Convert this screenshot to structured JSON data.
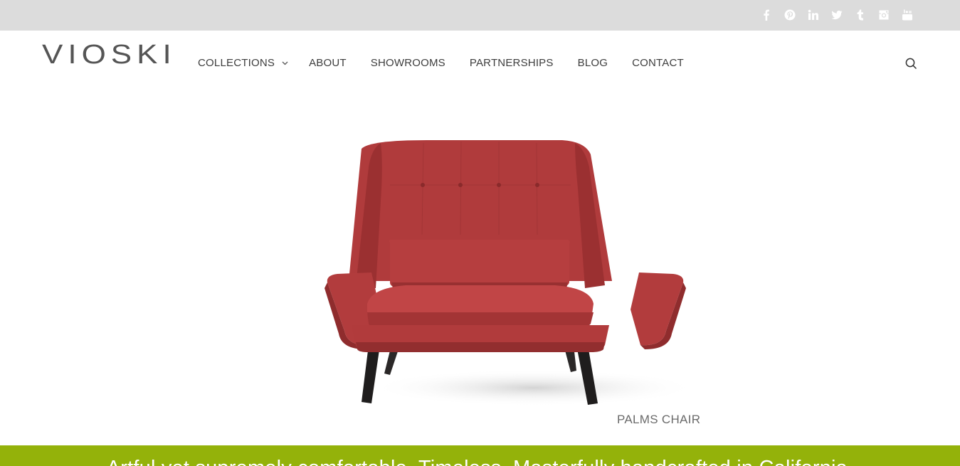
{
  "brand": {
    "name": "VIOSKI"
  },
  "social": [
    {
      "name": "facebook-icon"
    },
    {
      "name": "pinterest-icon"
    },
    {
      "name": "linkedin-icon"
    },
    {
      "name": "twitter-icon"
    },
    {
      "name": "tumblr-icon"
    },
    {
      "name": "instagram-icon"
    },
    {
      "name": "youtube-icon"
    }
  ],
  "nav": {
    "items": [
      {
        "label": "COLLECTIONS",
        "has_dropdown": true
      },
      {
        "label": "ABOUT"
      },
      {
        "label": "SHOWROOMS"
      },
      {
        "label": "PARTNERSHIPS"
      },
      {
        "label": "BLOG"
      },
      {
        "label": "CONTACT"
      }
    ],
    "search_icon": "search-icon"
  },
  "hero": {
    "product_caption": "PALMS CHAIR",
    "chair_color": "#b3393b"
  },
  "band": {
    "tagline": "Artful yet supremely comfortable. Timeless. Masterfully handcrafted in California.",
    "color": "#94b20a"
  },
  "colors": {
    "topbar": "#dcdcdc",
    "text": "#3d3d3d"
  }
}
